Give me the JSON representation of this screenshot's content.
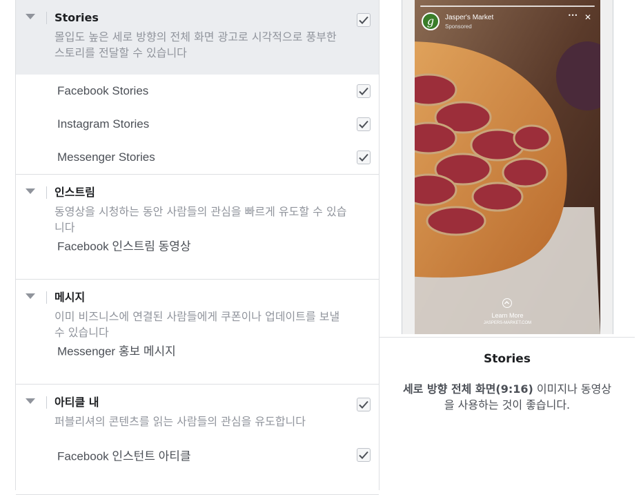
{
  "groups": [
    {
      "title": "Stories",
      "description": "몰입도 높은 세로 방향의 전체 화면 광고로 시각적으로 풍부한 스토리를 전달할 수 있습니다",
      "checked": true,
      "items": [
        {
          "label": "Facebook Stories",
          "checked": true
        },
        {
          "label": "Instagram Stories",
          "checked": true
        },
        {
          "label": "Messenger Stories",
          "checked": true
        }
      ]
    },
    {
      "title": "인스트림",
      "description": "동영상을 시청하는 동안 사람들의 관심을 빠르게 유도할 수 있습니다",
      "items": [
        {
          "label": "Facebook 인스트림 동영상"
        }
      ]
    },
    {
      "title": "메시지",
      "description": "이미 비즈니스에 연결된 사람들에게 쿠폰이나 업데이트를 보낼 수 있습니다",
      "items": [
        {
          "label": "Messenger 홍보 메시지"
        }
      ]
    },
    {
      "title": "아티클 내",
      "description": "퍼블리셔의 콘텐츠를 읽는 사람들의 관심을 유도합니다",
      "checked": true,
      "items": [
        {
          "label": "Facebook 인스턴트 아티클",
          "checked": true
        }
      ]
    }
  ],
  "preview": {
    "advertiser": "Jasper's Market",
    "sponsored": "Sponsored",
    "more_glyph": "•••",
    "close_glyph": "✕",
    "logo_letter": "g",
    "cta": "Learn More",
    "url": "JASPERS-MARKET.COM",
    "title": "Stories",
    "desc_bold": "세로 방향 전체 화면(9:16)",
    "desc_rest": " 이미지나 동영상을 사용하는 것이 좋습니다."
  },
  "colors": {
    "accent": "#4b4f56",
    "muted": "#90949c",
    "active_bg": "#ebedf0",
    "border": "#dddfe2"
  }
}
